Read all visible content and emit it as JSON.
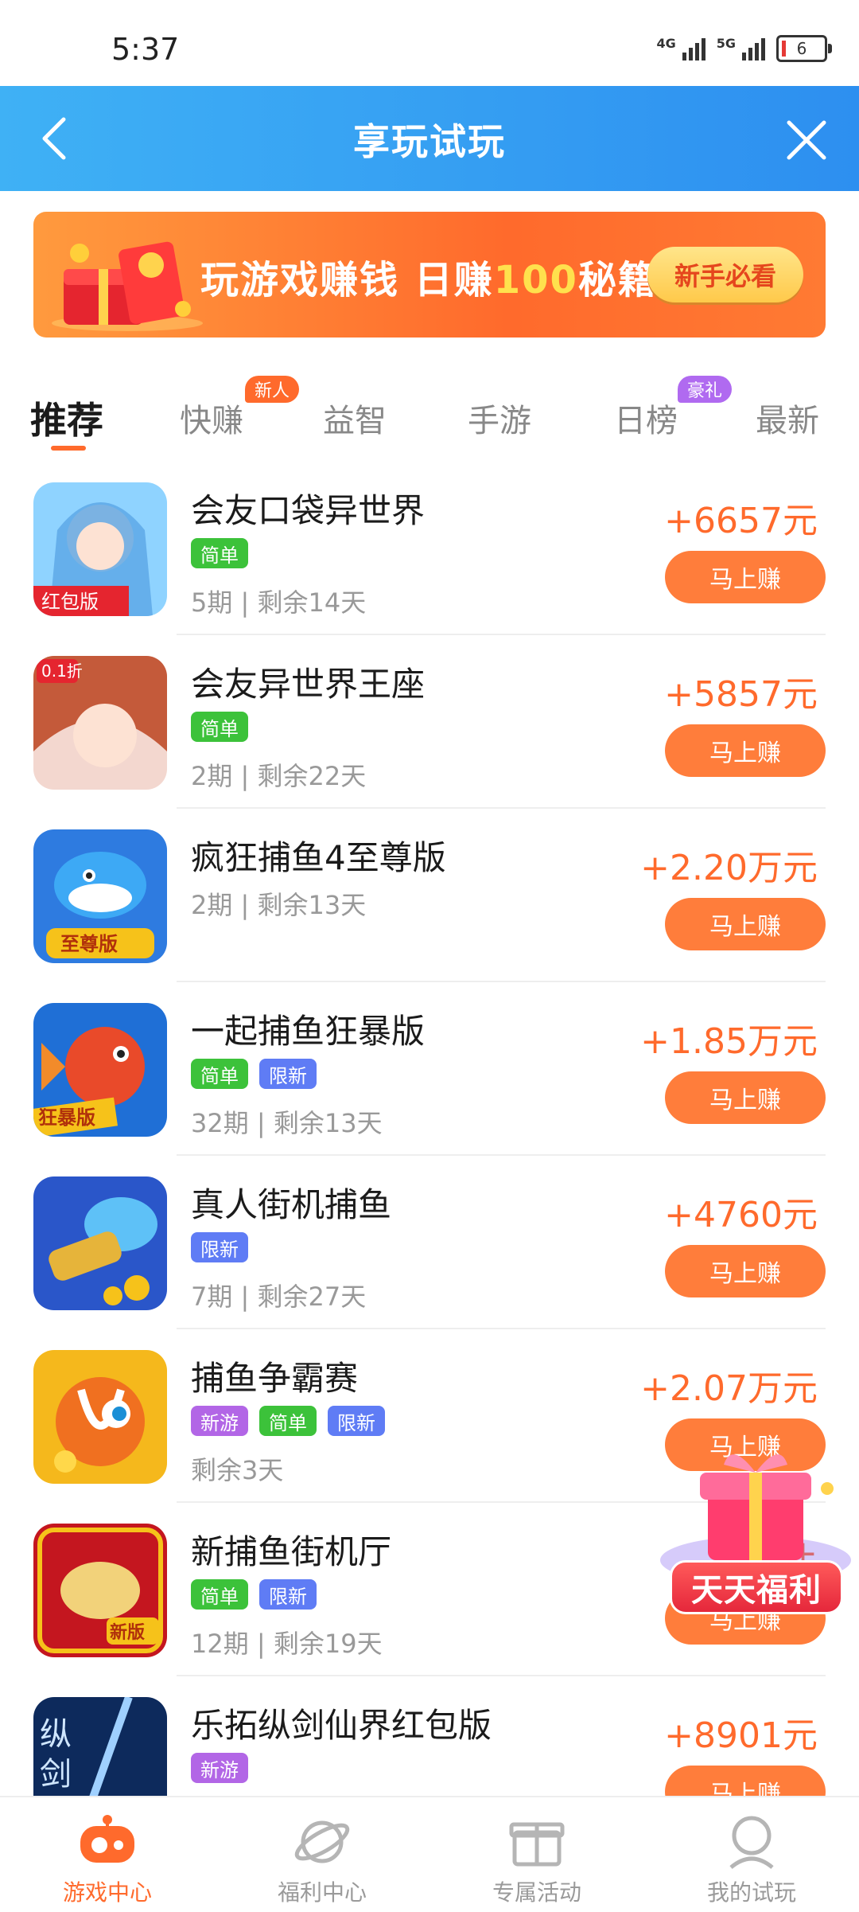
{
  "status": {
    "time": "5:37",
    "net1": "4G",
    "net2": "5G",
    "battery": "6"
  },
  "header": {
    "title": "享玩试玩"
  },
  "banner": {
    "text_a": "玩游戏赚钱 日赚",
    "text_b": "100",
    "text_c": "秘籍",
    "button": "新手必看"
  },
  "tabs": [
    {
      "label": "推荐",
      "active": true
    },
    {
      "label": "快赚",
      "badge": "新人",
      "badge_color": "#ff6a2c"
    },
    {
      "label": "益智"
    },
    {
      "label": "手游"
    },
    {
      "label": "日榜",
      "badge": "豪礼",
      "badge_color": "#b06af0"
    },
    {
      "label": "最新"
    }
  ],
  "tag_colors": {
    "简单": "#3cc23a",
    "限新": "#5f7cf5",
    "新游": "#b266e6"
  },
  "items": [
    {
      "name": "会友口袋异世界",
      "tags": [
        "简单"
      ],
      "meta": "5期 | 剩余14天",
      "reward": "+6657元",
      "button": "马上赚"
    },
    {
      "name": "会友异世界王座",
      "tags": [
        "简单"
      ],
      "meta": "2期 | 剩余22天",
      "reward": "+5857元",
      "button": "马上赚"
    },
    {
      "name": "疯狂捕鱼4至尊版",
      "tags": [],
      "meta": "2期 | 剩余13天",
      "reward": "+2.20万元",
      "button": "马上赚"
    },
    {
      "name": "一起捕鱼狂暴版",
      "tags": [
        "简单",
        "限新"
      ],
      "meta": "32期 | 剩余13天",
      "reward": "+1.85万元",
      "button": "马上赚"
    },
    {
      "name": "真人街机捕鱼",
      "tags": [
        "限新"
      ],
      "meta": "7期 | 剩余27天",
      "reward": "+4760元",
      "button": "马上赚"
    },
    {
      "name": "捕鱼争霸赛",
      "tags": [
        "新游",
        "简单",
        "限新"
      ],
      "meta": "剩余3天",
      "reward": "+2.07万元",
      "button": "马上赚"
    },
    {
      "name": "新捕鱼街机厅",
      "tags": [
        "简单",
        "限新"
      ],
      "meta": "12期 | 剩余19天",
      "reward": "+",
      "button": "马上赚"
    },
    {
      "name": "乐拓纵剑仙界红包版",
      "tags": [
        "新游"
      ],
      "meta": "",
      "reward": "+8901元",
      "button": "马上赚"
    }
  ],
  "float_promo": {
    "label": "天天福利"
  },
  "nav": [
    {
      "label": "游戏中心",
      "icon": "gamepad-icon",
      "active": true
    },
    {
      "label": "福利中心",
      "icon": "planet-icon"
    },
    {
      "label": "专属活动",
      "icon": "gift-icon"
    },
    {
      "label": "我的试玩",
      "icon": "user-icon"
    }
  ]
}
